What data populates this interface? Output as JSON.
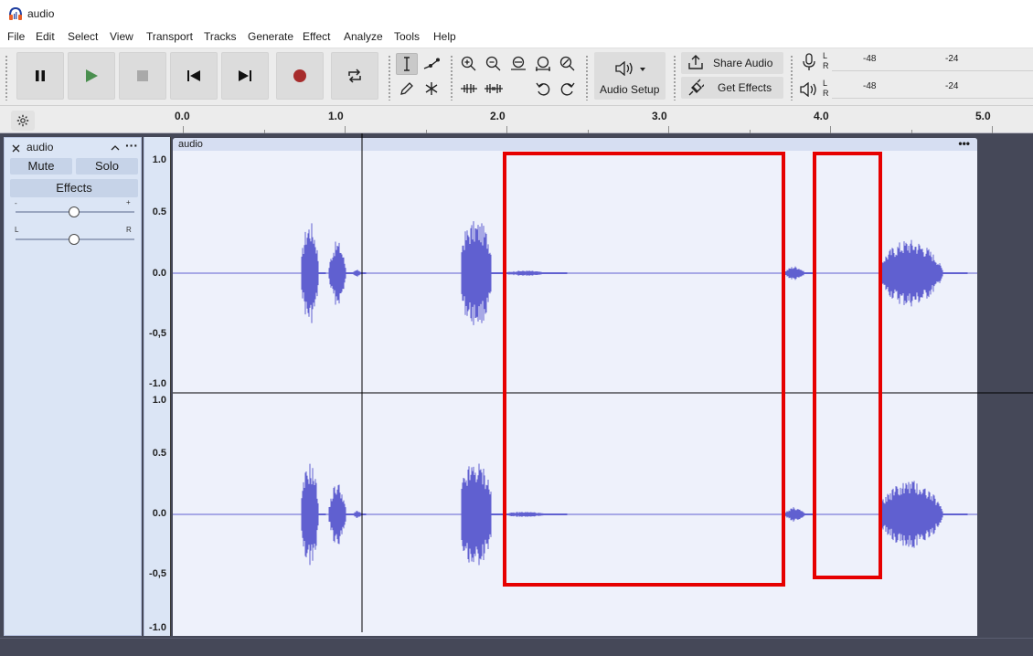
{
  "window": {
    "title": "audio"
  },
  "menu": [
    "File",
    "Edit",
    "Select",
    "View",
    "Transport",
    "Tracks",
    "Generate",
    "Effect",
    "Analyze",
    "Tools",
    "Help"
  ],
  "toolbar": {
    "audio_setup_label": "Audio Setup",
    "share_audio_label": "Share Audio",
    "get_effects_label": "Get Effects",
    "meter_channels": [
      "L",
      "R"
    ],
    "meter_ticks": [
      "-48",
      "-24"
    ]
  },
  "ruler": {
    "labels": [
      "0.0",
      "1.0",
      "2.0",
      "3.0",
      "4.0",
      "5.0"
    ]
  },
  "track": {
    "name": "audio",
    "mute_label": "Mute",
    "solo_label": "Solo",
    "effects_label": "Effects",
    "gain_minus": "-",
    "gain_plus": "+",
    "pan_left": "L",
    "pan_right": "R",
    "clip_name": "audio",
    "clip_menu": "•••",
    "menu_dots": "···",
    "vruler_labels": [
      "1.0",
      "0.5",
      "0.0",
      "-0,5",
      "-1.0",
      "1.0",
      "0.5",
      "0.0",
      "-0,5",
      "-1.0"
    ]
  },
  "colors": {
    "waveform": "#6060d0",
    "clip_background": "#eef1fb",
    "annotation": "#e60000",
    "record": "#a72c2c",
    "play": "#4a8f4f"
  }
}
